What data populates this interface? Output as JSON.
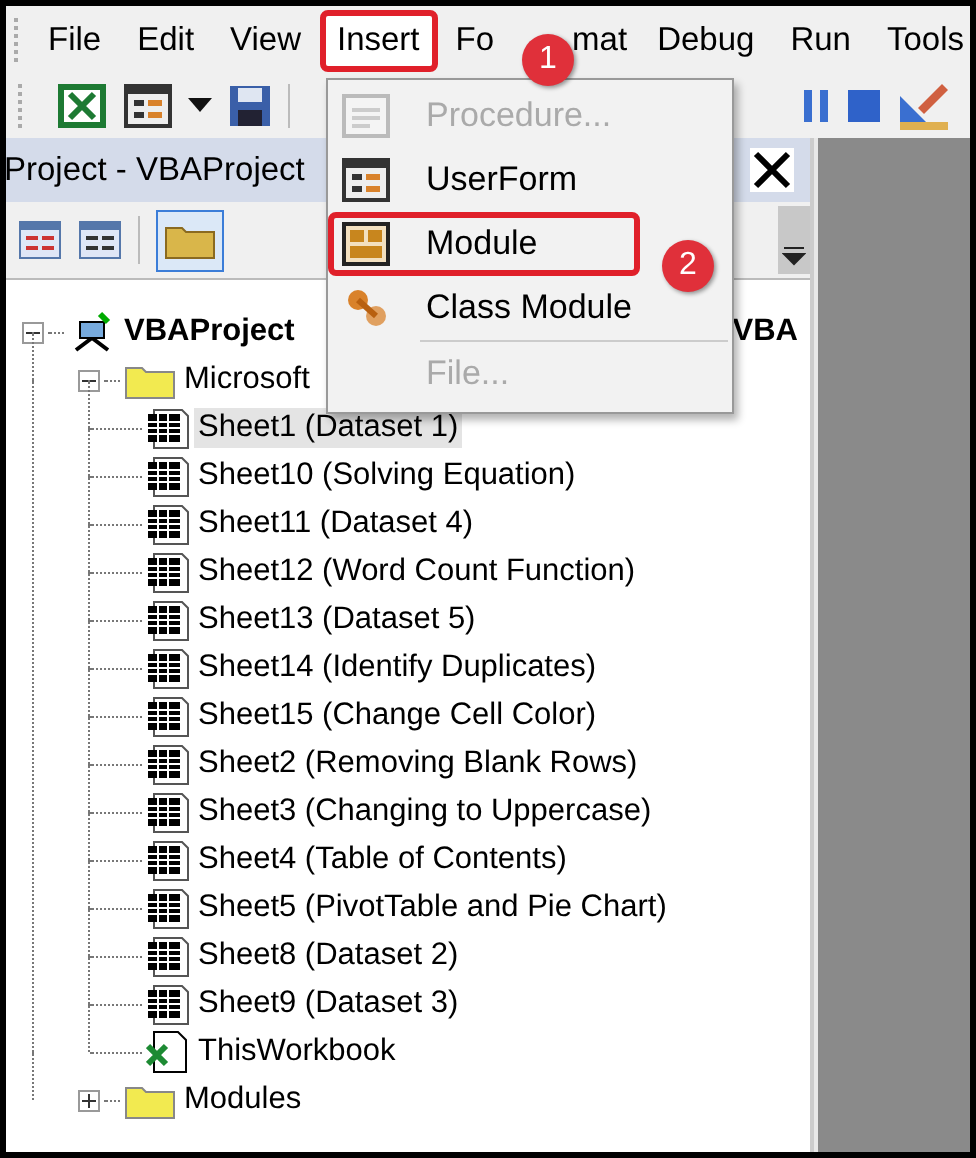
{
  "menu_bar": [
    {
      "label": "File",
      "open": false
    },
    {
      "label": "Edit",
      "open": false
    },
    {
      "label": "View",
      "open": false
    },
    {
      "label": "Insert",
      "open": true
    },
    {
      "label": "Fo",
      "label_after": "mat",
      "open": false
    },
    {
      "label": "Debug",
      "open": false
    },
    {
      "label": "Run",
      "open": false
    },
    {
      "label": "Tools",
      "open": false
    }
  ],
  "project_panel": {
    "title": "Project - VBAProject"
  },
  "tree": [
    {
      "label": "VBAProject",
      "tail": "VBA",
      "kind": "project",
      "expanded": true,
      "selected": false,
      "children": [
        {
          "label": "Microsoft",
          "kind": "folder",
          "expanded": true,
          "selected": false,
          "children": [
            {
              "label": "Sheet1 (Dataset 1)",
              "kind": "sheet",
              "selected": true
            },
            {
              "label": "Sheet10 (Solving Equation)",
              "kind": "sheet",
              "selected": false
            },
            {
              "label": "Sheet11 (Dataset 4)",
              "kind": "sheet",
              "selected": false
            },
            {
              "label": "Sheet12 (Word Count Function)",
              "kind": "sheet",
              "selected": false
            },
            {
              "label": "Sheet13 (Dataset 5)",
              "kind": "sheet",
              "selected": false
            },
            {
              "label": "Sheet14 (Identify Duplicates)",
              "kind": "sheet",
              "selected": false
            },
            {
              "label": "Sheet15 (Change Cell Color)",
              "kind": "sheet",
              "selected": false
            },
            {
              "label": "Sheet2 (Removing Blank Rows)",
              "kind": "sheet",
              "selected": false
            },
            {
              "label": "Sheet3 (Changing to Uppercase)",
              "kind": "sheet",
              "selected": false
            },
            {
              "label": "Sheet4 (Table of Contents)",
              "kind": "sheet",
              "selected": false
            },
            {
              "label": "Sheet5 (PivotTable and Pie Chart)",
              "kind": "sheet",
              "selected": false
            },
            {
              "label": "Sheet8 (Dataset 2)",
              "kind": "sheet",
              "selected": false
            },
            {
              "label": "Sheet9 (Dataset 3)",
              "kind": "sheet",
              "selected": false
            },
            {
              "label": "ThisWorkbook",
              "kind": "workbook",
              "selected": false
            }
          ]
        },
        {
          "label": "Modules",
          "kind": "folder",
          "expanded": false,
          "selected": false
        }
      ]
    }
  ],
  "insert_menu": [
    {
      "label": "Procedure...",
      "kind": "procedure",
      "disabled": true,
      "selected": false
    },
    {
      "label": "UserForm",
      "kind": "userform",
      "disabled": false,
      "selected": false
    },
    {
      "label": "Module",
      "kind": "module",
      "disabled": false,
      "selected": true
    },
    {
      "label": "Class Module",
      "kind": "class",
      "disabled": false,
      "selected": false
    },
    {
      "label": "File...",
      "kind": "file",
      "disabled": true,
      "selected": false
    }
  ],
  "callouts": [
    {
      "number": "1"
    },
    {
      "number": "2"
    }
  ]
}
